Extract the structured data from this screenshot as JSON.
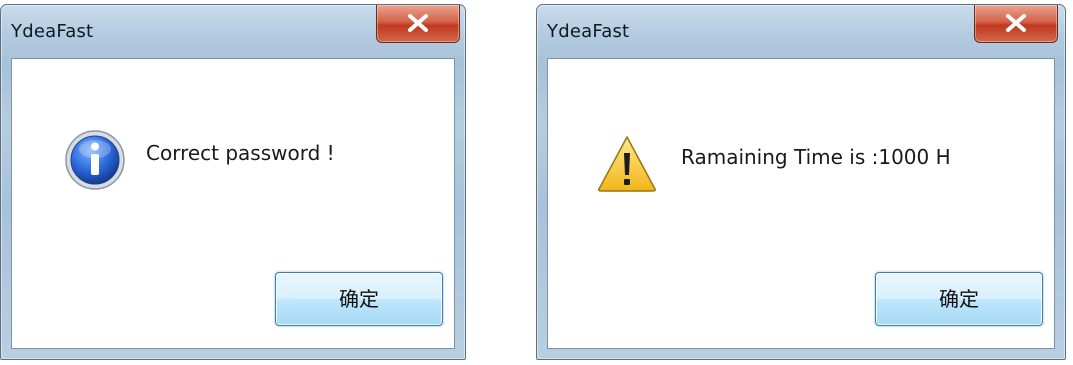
{
  "dialogs": [
    {
      "title": "YdeaFast",
      "message": "Correct password !",
      "icon": "info-icon",
      "ok_label": "确定"
    },
    {
      "title": "YdeaFast",
      "message": "Ramaining Time is :1000 H",
      "icon": "warning-icon",
      "ok_label": "确定"
    }
  ],
  "colors": {
    "close_button": "#c8432a",
    "ok_button_border": "#3c7fb1",
    "frame": "#b3cbe0"
  }
}
